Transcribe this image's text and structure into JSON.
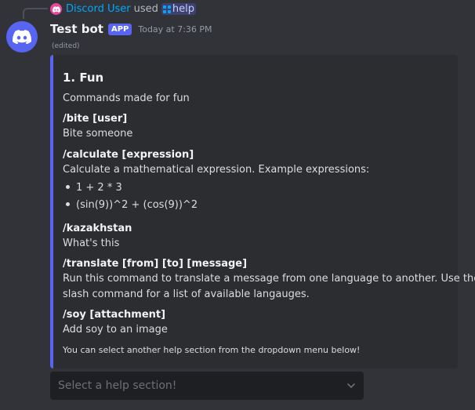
{
  "interaction": {
    "user": "Discord User",
    "used": "used",
    "command": "help"
  },
  "message": {
    "author": "Test bot",
    "badge": "APP",
    "timestamp": "Today at 7:36 PM",
    "edited": "(edited)"
  },
  "embed": {
    "accent_color": "#5865f2",
    "title": "1. Fun",
    "description": "Commands made for fun",
    "fields": [
      {
        "name": "/bite [user]",
        "value": "Bite someone"
      },
      {
        "name": "/calculate [expression]",
        "value": "Calculate a mathematical expression. Example expressions:",
        "bullets": [
          "1 + 2 * 3",
          "(sin(9))^2 + (cos(9))^2"
        ]
      },
      {
        "name": "/kazakhstan",
        "value": "What's this"
      },
      {
        "name": "/translate [from] [to] [message]",
        "value_lines": [
          "Run this command to translate a message from one language to another. Use the",
          "slash command for a list of available langauges."
        ]
      },
      {
        "name": "/soy [attachment]",
        "value": "Add soy to an image"
      }
    ],
    "footer": "You can select another help section from the dropdown menu below!"
  },
  "select": {
    "placeholder": "Select a help section!"
  }
}
